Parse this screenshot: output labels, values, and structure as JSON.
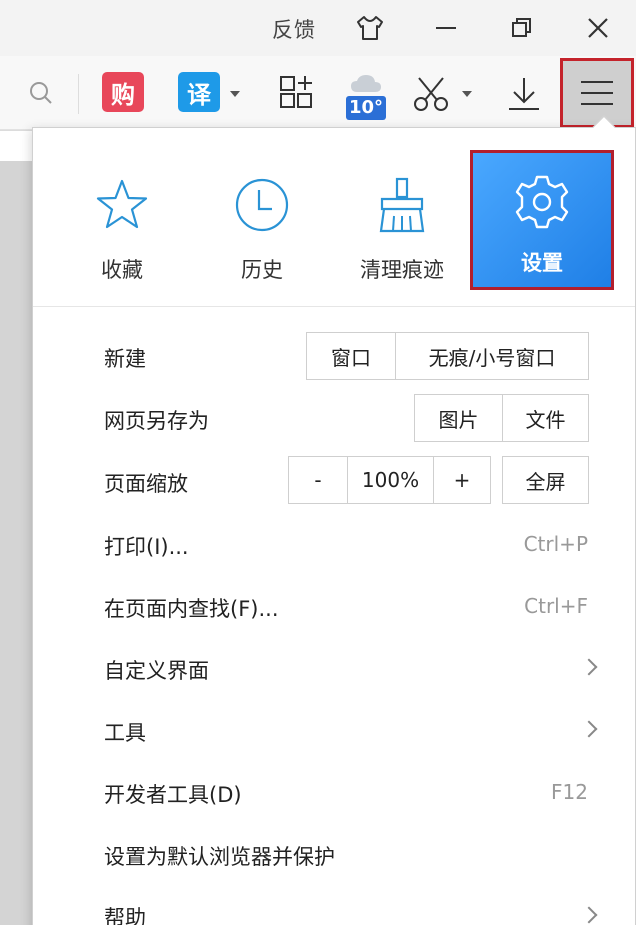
{
  "titlebar": {
    "feedback_label": "反馈",
    "icons": [
      "skin-icon",
      "minimize-icon",
      "restore-icon",
      "close-icon"
    ]
  },
  "toolbar": {
    "shop_badge": "购",
    "translate_badge": "译",
    "weather_temp": "10°",
    "colors": {
      "shop": "#e8475a",
      "translate": "#1e9ae8",
      "weather_badge": "#2b6fd6"
    }
  },
  "quick_actions": [
    {
      "label": "收藏",
      "icon": "star-icon"
    },
    {
      "label": "历史",
      "icon": "clock-icon"
    },
    {
      "label": "清理痕迹",
      "icon": "broom-icon"
    },
    {
      "label": "设置",
      "icon": "gear-icon"
    }
  ],
  "menu": {
    "new_label": "新建",
    "new_window": "窗口",
    "new_incognito": "无痕/小号窗口",
    "save_as_label": "网页另存为",
    "save_image": "图片",
    "save_file": "文件",
    "zoom_label": "页面缩放",
    "zoom_minus": "-",
    "zoom_value": "100%",
    "zoom_plus": "+",
    "fullscreen": "全屏",
    "print_label": "打印(I)...",
    "print_shortcut": "Ctrl+P",
    "find_label": "在页面内查找(F)...",
    "find_shortcut": "Ctrl+F",
    "customize_label": "自定义界面",
    "tools_label": "工具",
    "devtools_label": "开发者工具(D)",
    "devtools_shortcut": "F12",
    "default_browser_label": "设置为默认浏览器并保护",
    "help_label": "帮助"
  }
}
